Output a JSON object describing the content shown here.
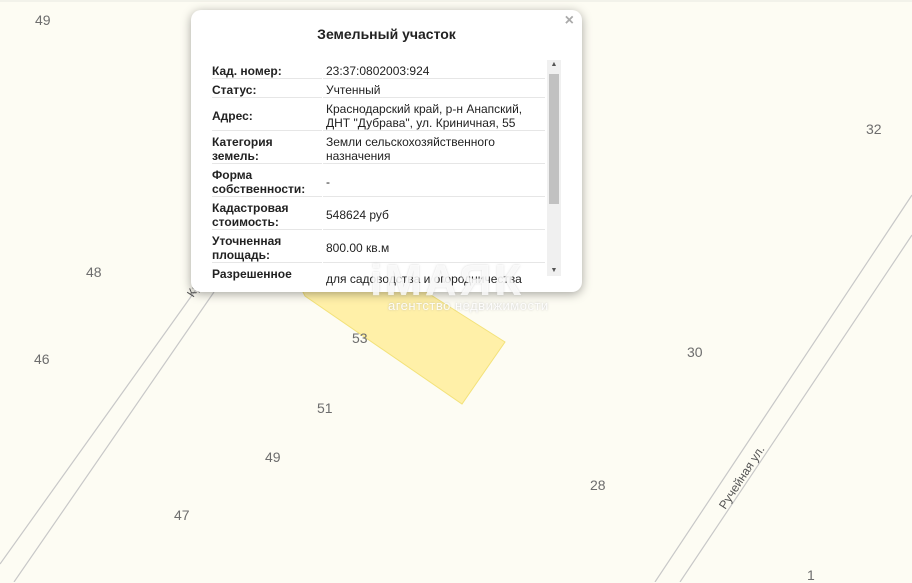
{
  "map": {
    "plot_numbers": {
      "n49_top": "49",
      "n32": "32",
      "n48": "48",
      "n46": "46",
      "n53": "53",
      "n30": "30",
      "n51": "51",
      "n49": "49",
      "n28": "28",
      "n47": "47",
      "n1": "1"
    },
    "streets": {
      "left_partial": "Кр",
      "right": "Ручейная ул."
    },
    "highlight_color": "#fff0a8",
    "background_color": "#fdfcf3"
  },
  "watermark": {
    "title": "iМАЯК",
    "subtitle": "агентство недвижимости"
  },
  "popup": {
    "title": "Земельный участок",
    "close": "×",
    "rows": [
      {
        "key": "Кад. номер:",
        "value": "23:37:0802003:924"
      },
      {
        "key": "Статус:",
        "value": "Учтенный"
      },
      {
        "key": "Адрес:",
        "value": "Краснодарский край, р-н Анапский, ДНТ \"Дубрава\", ул. Криничная, 55"
      },
      {
        "key": "Категория земель:",
        "value": "Земли сельскохозяйственного назначения"
      },
      {
        "key": "Форма собственности:",
        "value": "-"
      },
      {
        "key": "Кадастровая стоимость:",
        "value": "548624 руб"
      },
      {
        "key": "Уточненная площадь:",
        "value": "800.00 кв.м"
      },
      {
        "key": "Разрешенное",
        "value": "для садоводства и огородничества"
      }
    ]
  }
}
